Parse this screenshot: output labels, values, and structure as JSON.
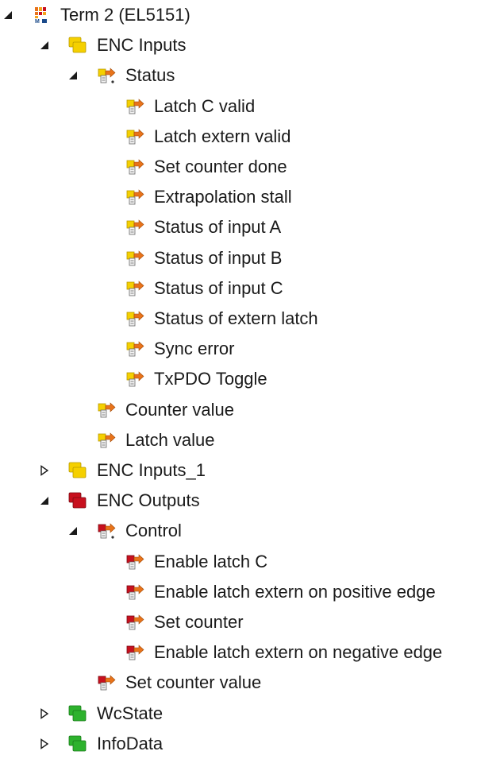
{
  "tree": [
    {
      "label": "Term 2 (EL5151)",
      "level": 0,
      "toggle": "expanded",
      "icon": "terminal-icon"
    },
    {
      "label": "ENC Inputs",
      "level": 1,
      "toggle": "expanded",
      "icon": "input-group-icon"
    },
    {
      "label": "Status",
      "level": 2,
      "toggle": "expanded",
      "icon": "input-var-struct-icon"
    },
    {
      "label": "Latch C valid",
      "level": 3,
      "toggle": "none",
      "icon": "input-var-icon"
    },
    {
      "label": "Latch extern valid",
      "level": 3,
      "toggle": "none",
      "icon": "input-var-icon"
    },
    {
      "label": "Set counter done",
      "level": 3,
      "toggle": "none",
      "icon": "input-var-icon"
    },
    {
      "label": "Extrapolation stall",
      "level": 3,
      "toggle": "none",
      "icon": "input-var-icon"
    },
    {
      "label": "Status of input A",
      "level": 3,
      "toggle": "none",
      "icon": "input-var-icon"
    },
    {
      "label": "Status of input B",
      "level": 3,
      "toggle": "none",
      "icon": "input-var-icon"
    },
    {
      "label": "Status of input C",
      "level": 3,
      "toggle": "none",
      "icon": "input-var-icon"
    },
    {
      "label": "Status of extern latch",
      "level": 3,
      "toggle": "none",
      "icon": "input-var-icon"
    },
    {
      "label": "Sync error",
      "level": 3,
      "toggle": "none",
      "icon": "input-var-icon"
    },
    {
      "label": "TxPDO Toggle",
      "level": 3,
      "toggle": "none",
      "icon": "input-var-icon"
    },
    {
      "label": "Counter value",
      "level": 2,
      "toggle": "none",
      "icon": "input-var-icon"
    },
    {
      "label": "Latch value",
      "level": 2,
      "toggle": "none",
      "icon": "input-var-icon"
    },
    {
      "label": "ENC Inputs_1",
      "level": 1,
      "toggle": "collapsed",
      "icon": "input-group-icon"
    },
    {
      "label": "ENC Outputs",
      "level": 1,
      "toggle": "expanded",
      "icon": "output-group-icon"
    },
    {
      "label": "Control",
      "level": 2,
      "toggle": "expanded",
      "icon": "output-var-struct-icon"
    },
    {
      "label": "Enable latch C",
      "level": 3,
      "toggle": "none",
      "icon": "output-var-icon"
    },
    {
      "label": "Enable latch extern on positive edge",
      "level": 3,
      "toggle": "none",
      "icon": "output-var-icon"
    },
    {
      "label": "Set counter",
      "level": 3,
      "toggle": "none",
      "icon": "output-var-icon"
    },
    {
      "label": "Enable latch extern on negative edge",
      "level": 3,
      "toggle": "none",
      "icon": "output-var-icon"
    },
    {
      "label": "Set counter value",
      "level": 2,
      "toggle": "none",
      "icon": "output-var-icon"
    },
    {
      "label": "WcState",
      "level": 1,
      "toggle": "collapsed",
      "icon": "status-group-icon"
    },
    {
      "label": "InfoData",
      "level": 1,
      "toggle": "collapsed",
      "icon": "status-group-icon"
    }
  ],
  "colors": {
    "input": "#f5d000",
    "output": "#c8101e",
    "status": "#2db22d",
    "arrow": "#e8731a",
    "toggle": "#1a1a1a"
  }
}
